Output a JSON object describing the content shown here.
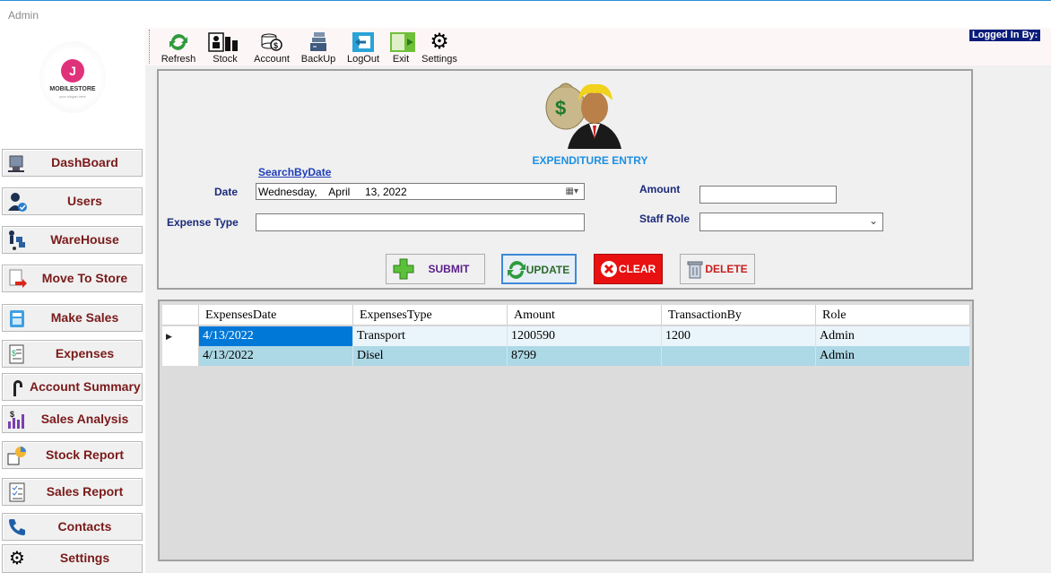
{
  "window": {
    "title": "Admin"
  },
  "logo": {
    "name": "MOBILESTORE",
    "slogan": "your slogan here"
  },
  "sidebar": {
    "items": [
      {
        "label": "DashBoard",
        "icon": "dashboard-icon"
      },
      {
        "label": "Users",
        "icon": "users-icon"
      },
      {
        "label": "WareHouse",
        "icon": "warehouse-icon"
      },
      {
        "label": "Move To Store",
        "icon": "move-icon"
      },
      {
        "label": "Make Sales",
        "icon": "sales-icon"
      },
      {
        "label": "Expenses",
        "icon": "expenses-icon"
      },
      {
        "label": "Account Summary",
        "icon": "account-summary-icon"
      },
      {
        "label": "Sales Analysis",
        "icon": "sales-analysis-icon"
      },
      {
        "label": "Stock Report",
        "icon": "stock-report-icon"
      },
      {
        "label": "Sales Report",
        "icon": "sales-report-icon"
      },
      {
        "label": "Contacts",
        "icon": "contacts-icon"
      },
      {
        "label": "Settings",
        "icon": "gear-icon"
      }
    ]
  },
  "toolbar": {
    "items": [
      {
        "label": "Refresh",
        "icon": "refresh-icon"
      },
      {
        "label": "Stock",
        "icon": "stock-icon"
      },
      {
        "label": "Account",
        "icon": "account-icon"
      },
      {
        "label": "BackUp",
        "icon": "backup-icon"
      },
      {
        "label": "LogOut",
        "icon": "logout-icon"
      },
      {
        "label": "Exit",
        "icon": "exit-icon"
      },
      {
        "label": "Settings",
        "icon": "gear-icon"
      }
    ],
    "logged_in": "Logged In By:"
  },
  "form": {
    "title": "EXPENDITURE ENTRY",
    "search_by_date": "SearchByDate",
    "date_label": "Date",
    "date_value": "Wednesday,    April     13, 2022",
    "expense_type_label": "Expense Type",
    "expense_type_value": "",
    "amount_label": "Amount",
    "amount_value": "",
    "staff_role_label": "Staff Role",
    "staff_role_value": ""
  },
  "actions": {
    "submit": "SUBMIT",
    "update": "UPDATE",
    "clear": "CLEAR",
    "delete": "DELETE"
  },
  "colors": {
    "nav_text": "#7a1a1a",
    "label_text": "#1b2a7a",
    "title_blue": "#1e8fe0",
    "clear_red": "#e81010",
    "selected_cell": "#0078d7",
    "alt_row": "#add8e6"
  },
  "grid": {
    "columns": [
      "ExpensesDate",
      "ExpensesType",
      "Amount",
      "TransactionBy",
      "Role"
    ],
    "rows": [
      [
        "4/13/2022",
        "Transport",
        "1200590",
        "1200",
        "Admin"
      ],
      [
        "4/13/2022",
        "Disel",
        "8799",
        "",
        "Admin"
      ]
    ]
  }
}
